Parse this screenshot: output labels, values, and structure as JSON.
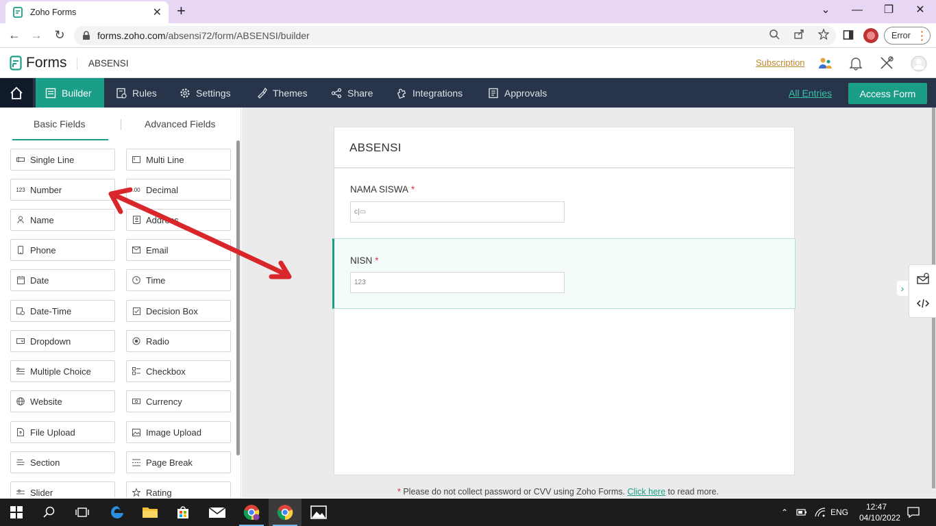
{
  "browser": {
    "tab_title": "Zoho Forms",
    "url_host": "forms.zoho.com",
    "url_path": "/absensi72/form/ABSENSI/builder",
    "error_label": "Error"
  },
  "header": {
    "logo_text": "Forms",
    "form_name": "ABSENSI",
    "subscription_label": "Subscription"
  },
  "nav": {
    "items": [
      {
        "label": "Builder",
        "icon": "builder-icon"
      },
      {
        "label": "Rules",
        "icon": "rules-icon"
      },
      {
        "label": "Settings",
        "icon": "gear-icon"
      },
      {
        "label": "Themes",
        "icon": "brush-icon"
      },
      {
        "label": "Share",
        "icon": "share-icon"
      },
      {
        "label": "Integrations",
        "icon": "puzzle-icon"
      },
      {
        "label": "Approvals",
        "icon": "approvals-icon"
      }
    ],
    "all_entries": "All Entries",
    "access_form": "Access Form"
  },
  "panel": {
    "tabs": [
      "Basic Fields",
      "Advanced Fields"
    ],
    "fields": [
      "Single Line",
      "Multi Line",
      "Number",
      "Decimal",
      "Name",
      "Address",
      "Phone",
      "Email",
      "Date",
      "Time",
      "Date-Time",
      "Decision Box",
      "Dropdown",
      "Radio",
      "Multiple Choice",
      "Checkbox",
      "Website",
      "Currency",
      "File Upload",
      "Image Upload",
      "Section",
      "Page Break",
      "Slider",
      "Rating"
    ]
  },
  "form": {
    "title": "ABSENSI",
    "fields": [
      {
        "label": "NAMA SISWA",
        "required_mark": "*",
        "placeholder_glyph": "c|▭"
      },
      {
        "label": "NISN",
        "required_mark": "*",
        "placeholder_glyph": "123"
      }
    ]
  },
  "footer": {
    "mark": "*",
    "text": " Please do not collect password or CVV using Zoho Forms. ",
    "link": "Click here",
    "text_after": " to read more."
  },
  "taskbar": {
    "lang": "ENG",
    "time": "12:47",
    "date": "04/10/2022"
  },
  "colors": {
    "accent": "#1a9e87",
    "nav_bg": "#283449",
    "required": "#e0313b",
    "annotation_arrow": "#d8262a"
  }
}
